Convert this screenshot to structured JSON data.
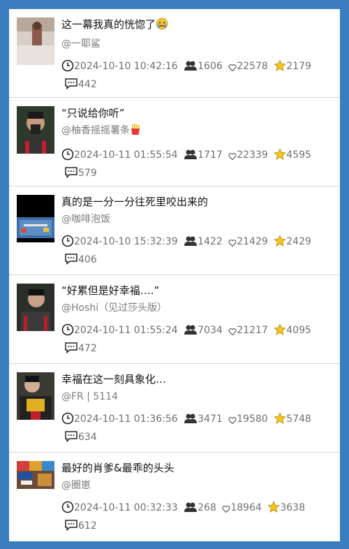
{
  "posts": [
    {
      "title": "这一幕我真的恍惚了",
      "emoji": "crying-face",
      "author": "@一耶鲨",
      "time": "2024-10-10 10:42:16",
      "users": "1606",
      "likes": "22578",
      "stars": "2179",
      "comments": "442",
      "thumb": "light"
    },
    {
      "title": "“只说给你听”",
      "emoji": "",
      "author": "@柚香摇摇薯条",
      "author_emoji": "fries",
      "time": "2024-10-11 01:55:54",
      "users": "1717",
      "likes": "22339",
      "stars": "4595",
      "comments": "579",
      "thumb": "dark"
    },
    {
      "title": "真的是一分一分往死里咬出来的",
      "emoji": "",
      "author": "@咖啡泡饭",
      "time": "2024-10-10 15:32:39",
      "users": "1422",
      "likes": "21429",
      "stars": "2429",
      "comments": "406",
      "thumb": "game"
    },
    {
      "title": "“好累但是好幸福….”",
      "emoji": "",
      "author": "@Hoshi（见过莎头版）",
      "time": "2024-10-11 01:55:24",
      "users": "7034",
      "likes": "21217",
      "stars": "4095",
      "comments": "472",
      "thumb": "dark"
    },
    {
      "title": "幸福在这一刻具象化…",
      "emoji": "",
      "author": "@FR | 5114",
      "time": "2024-10-11 01:36:56",
      "users": "3471",
      "likes": "19580",
      "stars": "5748",
      "comments": "634",
      "thumb": "dark2"
    },
    {
      "title": "最好的肖爹&最乖的头头",
      "emoji": "",
      "author": "@圈崽",
      "time": "2024-10-11 00:32:33",
      "users": "268",
      "likes": "18964",
      "stars": "3638",
      "comments": "612",
      "thumb": "colorful"
    }
  ],
  "icons": {
    "time": "clock-icon",
    "users": "users-icon",
    "likes": "heart-icon",
    "stars": "star-icon",
    "comments": "comment-icon"
  },
  "colors": {
    "background": "#3a7ebf",
    "card": "#ffffff",
    "star": "#f5c518"
  }
}
